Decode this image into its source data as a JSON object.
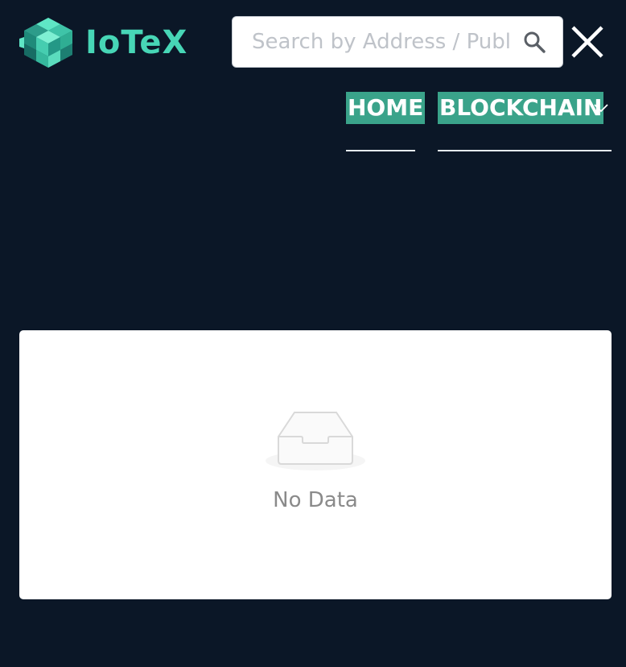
{
  "header": {
    "logo_text": "IoTeX",
    "search": {
      "placeholder": "Search by Address / Public Key / Block / Txn Hash",
      "value": ""
    }
  },
  "nav": {
    "items": [
      {
        "label": "HOME"
      },
      {
        "label": "BLOCKCHAIN"
      }
    ]
  },
  "content": {
    "empty_text": "No Data"
  },
  "colors": {
    "background": "#0b1727",
    "accent": "#3aa38a",
    "logo": "#47d6b6",
    "card": "#ffffff"
  },
  "icons": [
    "iotex-logo-icon",
    "search-icon",
    "close-icon",
    "chevron-down-icon",
    "empty-inbox-icon"
  ]
}
